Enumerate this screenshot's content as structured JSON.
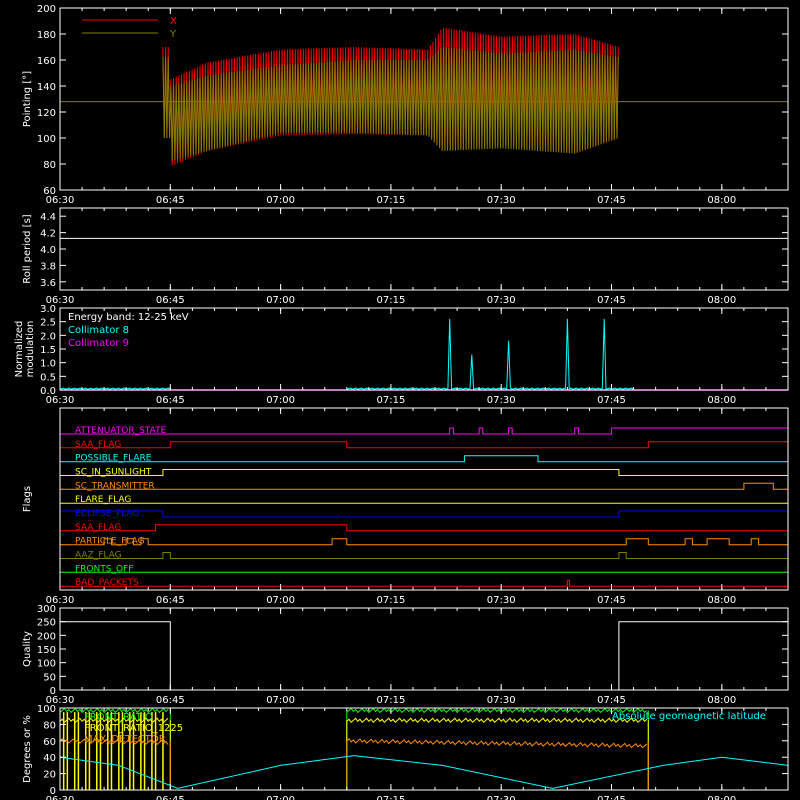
{
  "chart_data": [
    {
      "type": "line",
      "ylabel": "Pointing [°]",
      "ylim": [
        60,
        200
      ],
      "yticks": [
        "60",
        "80",
        "100",
        "120",
        "140",
        "160",
        "180",
        "200"
      ],
      "xticks": [
        "06:30",
        "06:45",
        "07:00",
        "07:15",
        "07:30",
        "07:45",
        "08:00"
      ],
      "legend": "top-left",
      "series": [
        {
          "name": "X",
          "color": "#ff0000"
        },
        {
          "name": "Y",
          "color": "#808000"
        }
      ],
      "reference_line": 128,
      "data_span": [
        "06:44",
        "07:46"
      ],
      "envelope": [
        {
          "t": "06:45",
          "x_max": 145,
          "x_min": 78,
          "y_max": 140,
          "y_min": 82
        },
        {
          "t": "06:50",
          "x_max": 158,
          "x_min": 90,
          "y_max": 148,
          "y_min": 90
        },
        {
          "t": "07:00",
          "x_max": 168,
          "x_min": 102,
          "y_max": 156,
          "y_min": 104
        },
        {
          "t": "07:10",
          "x_max": 170,
          "x_min": 103,
          "y_max": 160,
          "y_min": 104
        },
        {
          "t": "07:20",
          "x_max": 168,
          "x_min": 102,
          "y_max": 160,
          "y_min": 102
        },
        {
          "t": "07:22",
          "x_max": 185,
          "x_min": 90,
          "y_max": 170,
          "y_min": 90
        },
        {
          "t": "07:30",
          "x_max": 178,
          "x_min": 95,
          "y_max": 165,
          "y_min": 92
        },
        {
          "t": "07:40",
          "x_max": 180,
          "x_min": 88,
          "y_max": 168,
          "y_min": 88
        },
        {
          "t": "07:46",
          "x_max": 170,
          "x_min": 100,
          "y_max": 162,
          "y_min": 100
        }
      ]
    },
    {
      "type": "line",
      "ylabel": "Roll period [s]",
      "ylim": [
        3.5,
        4.5
      ],
      "yticks": [
        "3.6",
        "3.8",
        "4.0",
        "4.2",
        "4.4"
      ],
      "xticks": [
        "06:30",
        "06:45",
        "07:00",
        "07:15",
        "07:30",
        "07:45",
        "08:00"
      ],
      "series": [
        {
          "name": "",
          "color": "#ffffff",
          "value": 4.13
        }
      ]
    },
    {
      "type": "line",
      "ylabel": [
        "Normalized",
        "modulation"
      ],
      "ylim": [
        0,
        3.0
      ],
      "yticks": [
        "0.0",
        "0.5",
        "1.0",
        "1.5",
        "2.0",
        "2.5",
        "3.0"
      ],
      "xticks": [
        "06:30",
        "06:45",
        "07:00",
        "07:15",
        "07:30",
        "07:45",
        "08:00"
      ],
      "annotation": "Energy band: 12-25 keV",
      "legend": "top-left",
      "series": [
        {
          "name": "Collimator 8",
          "color": "#00ffff",
          "segments": [
            [
              "06:30",
              "06:45"
            ],
            [
              "07:09",
              "07:48"
            ]
          ],
          "baseline": 0.05,
          "spikes": [
            {
              "t": "07:23",
              "v": 2.6
            },
            {
              "t": "07:26",
              "v": 1.3
            },
            {
              "t": "07:31",
              "v": 1.8
            },
            {
              "t": "07:39",
              "v": 2.6
            },
            {
              "t": "07:44",
              "v": 2.6
            }
          ]
        },
        {
          "name": "Collimator 9",
          "color": "#ff00ff",
          "value": 0.0
        }
      ]
    },
    {
      "type": "line",
      "ylabel": "Flags",
      "xticks": [
        "06:30",
        "06:45",
        "07:00",
        "07:15",
        "07:30",
        "07:45",
        "08:00"
      ],
      "flags": [
        {
          "name": "ATTENUATOR_STATE",
          "color": "#ff00ff",
          "on": [
            [
              "07:23",
              "07:23.5"
            ],
            [
              "07:27",
              "07:27.5"
            ],
            [
              "07:31",
              "07:31.5"
            ],
            [
              "07:40",
              "07:40.5"
            ],
            [
              "07:45",
              "08:09"
            ]
          ]
        },
        {
          "name": "SAA_FLAG",
          "color": "#ff0000",
          "on": [
            [
              "06:45",
              "07:09"
            ],
            [
              "07:50",
              "08:09"
            ]
          ]
        },
        {
          "name": "POSSIBLE_FLARE",
          "color": "#00ffff",
          "on": [
            [
              "07:25",
              "07:35"
            ]
          ]
        },
        {
          "name": "SC_IN_SUNLIGHT",
          "color": "#ffff00",
          "on": [
            [
              "06:44",
              "07:46"
            ]
          ]
        },
        {
          "name": "SC_TRANSMITTER",
          "color": "#ff8c00",
          "on": [
            [
              "08:03",
              "08:07"
            ]
          ]
        },
        {
          "name": "FLARE_FLAG",
          "color": "#ffff00",
          "on": []
        },
        {
          "name": "ECLIPSE_FLAG",
          "color": "#0000ff",
          "on": [
            [
              "06:30",
              "06:44"
            ],
            [
              "07:46",
              "08:09"
            ]
          ]
        },
        {
          "name": "SAA_FLAG",
          "color": "#ff0000",
          "on": [
            [
              "06:43",
              "07:09"
            ]
          ]
        },
        {
          "name": "PARTICLE_FLAG",
          "color": "#ff8c00",
          "on": [
            [
              "06:36",
              "06:37"
            ],
            [
              "06:39",
              "06:40"
            ],
            [
              "06:41",
              "06:42"
            ],
            [
              "07:07",
              "07:09"
            ],
            [
              "07:47",
              "07:50"
            ],
            [
              "07:55",
              "07:56"
            ],
            [
              "07:58",
              "08:01"
            ],
            [
              "08:04",
              "08:05"
            ]
          ]
        },
        {
          "name": "AAZ_FLAG",
          "color": "#808000",
          "on": [
            [
              "06:44",
              "06:45"
            ],
            [
              "07:46",
              "07:47"
            ]
          ]
        },
        {
          "name": "FRONTS_OFF",
          "color": "#00ff00",
          "on": []
        },
        {
          "name": "BAD_PACKETS",
          "color": "#ff0000",
          "on": [
            [
              "07:39",
              "07:39.3"
            ]
          ]
        }
      ]
    },
    {
      "type": "line",
      "ylabel": "Quality",
      "ylim": [
        0,
        300
      ],
      "yticks": [
        "0",
        "50",
        "100",
        "150",
        "200",
        "250",
        "300"
      ],
      "xticks": [
        "06:30",
        "06:45",
        "07:00",
        "07:15",
        "07:30",
        "07:45",
        "08:00"
      ],
      "series": [
        {
          "name": "",
          "color": "#ffffff",
          "steps": [
            [
              "06:30",
              250
            ],
            [
              "06:45",
              0
            ],
            [
              "07:46",
              250
            ],
            [
              "08:09",
              250
            ]
          ]
        }
      ]
    },
    {
      "type": "line",
      "ylabel": "Degrees or %",
      "ylim": [
        0,
        100
      ],
      "yticks": [
        "0",
        "20",
        "40",
        "60",
        "80",
        "100"
      ],
      "xticks": [
        "06:30",
        "06:45",
        "07:00",
        "07:15",
        "07:30",
        "07:45",
        "08:00"
      ],
      "legend_labels": [
        "FRONT_RATIO",
        "FRONT_RATIO_1225",
        "MAX_DETECTOR"
      ],
      "annotation": "Absolute geomagnetic latitude",
      "series": [
        {
          "name": "FRONT_RATIO",
          "color": "#00ff00",
          "segments": [
            [
              "06:30",
              "06:45"
            ],
            [
              "07:09",
              "07:50"
            ]
          ],
          "level": 97
        },
        {
          "name": "FRONT_RATIO_1225",
          "color": "#ffff00",
          "segments": [
            [
              "06:30",
              "06:45"
            ],
            [
              "07:09",
              "07:50"
            ]
          ],
          "level": 85
        },
        {
          "name": "MAX_DETECTOR",
          "color": "#ff8c00",
          "segments": [
            [
              "06:30",
              "06:45"
            ],
            [
              "07:09",
              "07:50"
            ]
          ],
          "level": 60
        },
        {
          "name": "Absolute geomagnetic latitude",
          "color": "#00ffff",
          "points": [
            [
              "06:30",
              40
            ],
            [
              "06:38",
              30
            ],
            [
              "06:46",
              2
            ],
            [
              "07:00",
              30
            ],
            [
              "07:10",
              42
            ],
            [
              "07:22",
              30
            ],
            [
              "07:37",
              2
            ],
            [
              "07:52",
              30
            ],
            [
              "08:00",
              40
            ],
            [
              "08:09",
              30
            ]
          ]
        }
      ]
    }
  ]
}
